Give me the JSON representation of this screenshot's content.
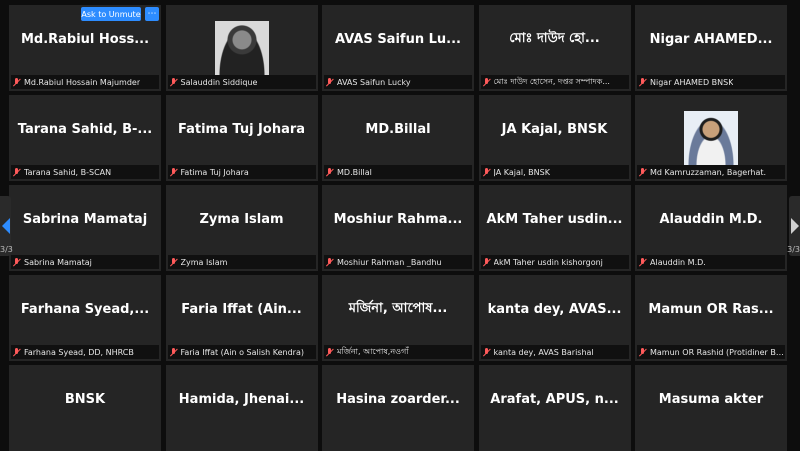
{
  "controls": {
    "ask_to_unmute": "Ask to Unmute",
    "more": "⋯"
  },
  "pager": {
    "left_indicator": "3/3",
    "right_indicator": "3/3"
  },
  "participants": [
    {
      "display": "Md.Rabiul Hoss...",
      "name": "Md.Rabiul Hossain Majumder"
    },
    {
      "display": "",
      "name": "Salauddin Siddique",
      "photo": "p1"
    },
    {
      "display": "AVAS Saifun Lu...",
      "name": "AVAS Saifun Lucky"
    },
    {
      "display": "মোঃ দাউদ হো...",
      "name": "মোঃ দাউদ হোসেন, দপ্তর সম্পাদক..."
    },
    {
      "display": "Nigar AHAMED...",
      "name": "Nigar AHAMED BNSK"
    },
    {
      "display": "Tarana Sahid, B-...",
      "name": "Tarana Sahid, B-SCAN"
    },
    {
      "display": "Fatima Tuj Johara",
      "name": "Fatima Tuj Johara"
    },
    {
      "display": "MD.Billal",
      "name": "MD.Billal"
    },
    {
      "display": "JA Kajal, BNSK",
      "name": "JA Kajal, BNSK"
    },
    {
      "display": "",
      "name": "Md Kamruzzaman, Bagerhat.",
      "photo": "p2"
    },
    {
      "display": "Sabrina Mamataj",
      "name": "Sabrina Mamataj"
    },
    {
      "display": "Zyma Islam",
      "name": "Zyma Islam"
    },
    {
      "display": "Moshiur Rahma...",
      "name": "Moshiur Rahman _Bandhu"
    },
    {
      "display": "AkM Taher usdin...",
      "name": "AkM Taher usdin kishorgonj"
    },
    {
      "display": "Alauddin M.D.",
      "name": "Alauddin M.D."
    },
    {
      "display": "Farhana Syead,...",
      "name": "Farhana Syead, DD, NHRCB"
    },
    {
      "display": "Faria Iffat (Ain...",
      "name": "Faria Iffat (Ain o Salish Kendra)"
    },
    {
      "display": "মর্জিনা, আপোষ...",
      "name": "মর্জিনা, আপোষ,নওগাঁ"
    },
    {
      "display": "kanta dey, AVAS...",
      "name": "kanta dey, AVAS Barishal"
    },
    {
      "display": "Mamun OR Ras...",
      "name": "Mamun OR Rashid (Protidiner Ban..."
    },
    {
      "display": "BNSK",
      "name": ""
    },
    {
      "display": "Hamida, Jhenai...",
      "name": ""
    },
    {
      "display": "Hasina zoarder...",
      "name": ""
    },
    {
      "display": "Arafat, APUS, n...",
      "name": ""
    },
    {
      "display": "Masuma akter",
      "name": ""
    }
  ]
}
